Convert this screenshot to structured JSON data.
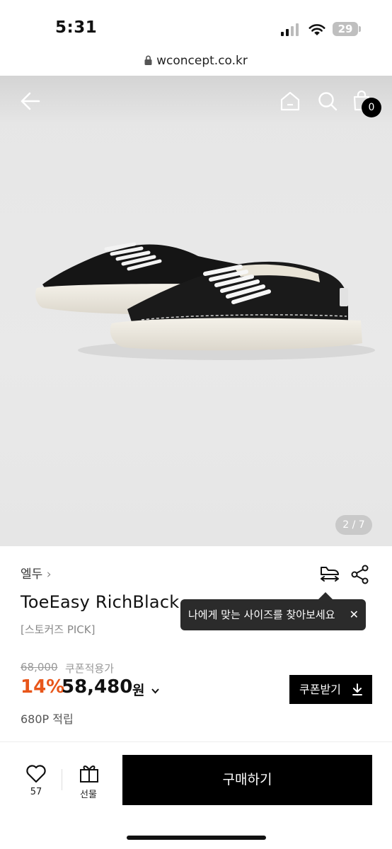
{
  "status_bar": {
    "time": "5:31",
    "battery": "29"
  },
  "browser": {
    "url": "wconcept.co.kr"
  },
  "header": {
    "cart_count": "0"
  },
  "gallery": {
    "page_indicator": "2 / 7"
  },
  "product": {
    "brand": "엘두",
    "title": "ToeEasy RichBlack",
    "subtitle": "[스토커즈 PICK]",
    "original_price": "68,000",
    "coupon_note": "쿠폰적용가",
    "discount": "14%",
    "price": "58,480",
    "currency": "원",
    "points": "680P 적립"
  },
  "size_tooltip": {
    "text": "나에게 맞는 사이즈를 찾아보세요"
  },
  "coupon_button": {
    "label": "쿠폰받기"
  },
  "bottom_bar": {
    "like_count": "57",
    "gift_label": "선물",
    "buy_label": "구매하기"
  },
  "colors": {
    "accent_discount": "#e8561a",
    "primary_button": "#000000"
  }
}
